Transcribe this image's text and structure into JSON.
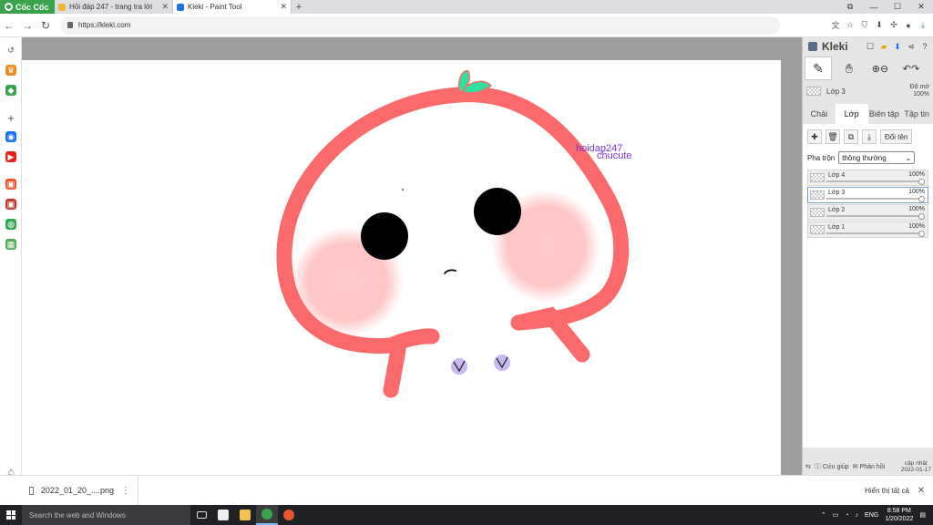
{
  "browser": {
    "brand": "Cốc Cốc",
    "tabs": [
      {
        "label": "Hỏi đáp 247 - trang tra lời",
        "color": "#f2b233"
      },
      {
        "label": "Kleki - Paint Tool",
        "color": "#1a73e8"
      }
    ],
    "new_tab": "+",
    "url": "https://kleki.com"
  },
  "canvas": {
    "text_line1": "hoidap247",
    "text_line2": "chucute",
    "text_color": "#7b34d6",
    "stroke_color": "#fa6a6a",
    "blush_color": "#ffb8b8",
    "leaf_color": "#2fe0a0",
    "foot_color": "#c9b8f2"
  },
  "panel": {
    "app_name": "Kleki",
    "layer_name": "Lớp 3",
    "opacity_label": "Độ mờ",
    "opacity_value": "100%",
    "tabs": [
      "Chải",
      "Lớp",
      "Biên tập",
      "Tập tin"
    ],
    "active_tab": "Lớp",
    "rename_label": "Đổi tên",
    "blend_label": "Pha trộn",
    "blend_value": "thông thường",
    "layers": [
      {
        "name": "Lớp 4",
        "opacity": "100%"
      },
      {
        "name": "Lớp 3",
        "opacity": "100%"
      },
      {
        "name": "Lớp 2",
        "opacity": "100%"
      },
      {
        "name": "Lớp 1",
        "opacity": "100%"
      }
    ],
    "footer": {
      "help": "Cứu giúp",
      "feedback": "Phản hồi",
      "update_line1": "cập nhật",
      "update_line2": "2022-01-17"
    }
  },
  "download_bar": {
    "file_name": "2022_01_20_....png",
    "show_all": "Hiển thị tất cả"
  },
  "taskbar": {
    "search_placeholder": "Search the web and Windows",
    "lang": "ENG",
    "time": "8:58 PM",
    "date": "1/20/2022"
  }
}
